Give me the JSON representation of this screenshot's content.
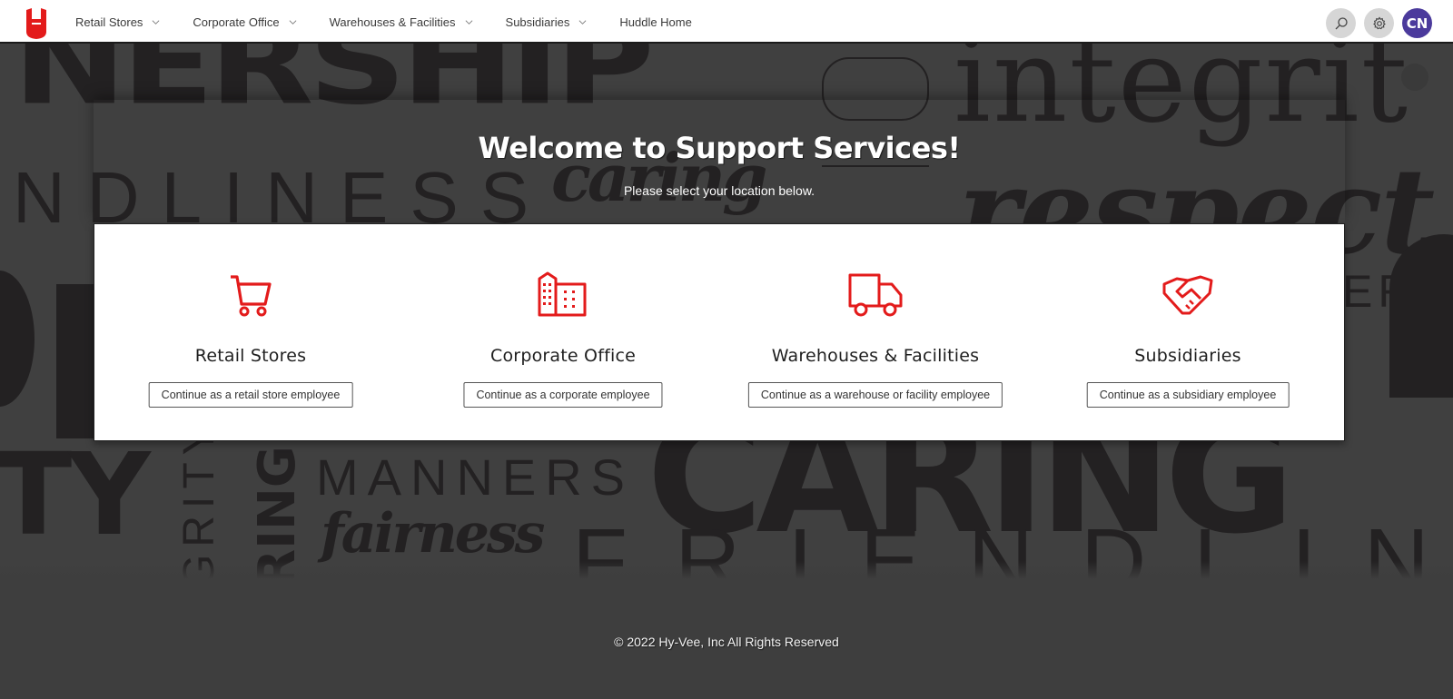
{
  "nav": {
    "items": [
      {
        "label": "Retail Stores",
        "has_dropdown": true
      },
      {
        "label": "Corporate Office",
        "has_dropdown": true
      },
      {
        "label": "Warehouses & Facilities",
        "has_dropdown": true
      },
      {
        "label": "Subsidiaries",
        "has_dropdown": true
      },
      {
        "label": "Huddle Home",
        "has_dropdown": false
      }
    ],
    "search_icon": "search-icon",
    "settings_icon": "gear-icon",
    "avatar_initials": "CN"
  },
  "colors": {
    "brand_red": "#e31b1b",
    "avatar_bg": "#4b3a9c",
    "page_bg": "#3e3e3e"
  },
  "background_words": [
    "NERSHIP",
    "integrit",
    "NDLINESS",
    "caring",
    "respect",
    "ERIT",
    "TY",
    "GRITY",
    "RING",
    "MANNERS",
    "fairness",
    "CARING",
    "FRIENDLINE"
  ],
  "hero": {
    "title": "Welcome to Support Services!",
    "subtitle": "Please select your location below."
  },
  "locations": [
    {
      "icon": "shopping-cart-icon",
      "label": "Retail Stores",
      "button": "Continue as a retail store employee"
    },
    {
      "icon": "office-building-icon",
      "label": "Corporate Office",
      "button": "Continue as a corporate employee"
    },
    {
      "icon": "delivery-truck-icon",
      "label": "Warehouses & Facilities",
      "button": "Continue as a warehouse or facility employee"
    },
    {
      "icon": "handshake-icon",
      "label": "Subsidiaries",
      "button": "Continue as a subsidiary employee"
    }
  ],
  "footer": {
    "copyright": "© 2022 Hy-Vee, Inc All Rights Reserved"
  }
}
